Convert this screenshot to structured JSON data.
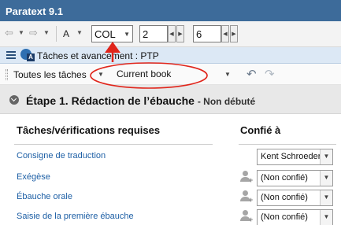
{
  "window": {
    "title": "Paratext 9.1"
  },
  "toolbar": {
    "back_icon": "back-arrow-icon",
    "forward_icon": "forward-arrow-icon",
    "font_label": "A",
    "book": "COL",
    "chapter": "2",
    "verse": "6"
  },
  "panel": {
    "title": "Tâches et avancement : PTP",
    "icon": "project-progress-icon"
  },
  "filterbar": {
    "task_filter": "Toutes les tâches",
    "book_range": "Current book",
    "undo_icon": "undo-icon",
    "redo_icon": "redo-icon"
  },
  "stage": {
    "title": "Étape 1. Rédaction de l’ébauche",
    "status": "- Non débuté"
  },
  "columns": {
    "tasks": "Tâches/vérifications requises",
    "assigned": "Confié à"
  },
  "tasks": [
    {
      "name": "Consigne de traduction",
      "assignee": "Kent Schroeder",
      "show_assign_icon": false
    },
    {
      "name": "Exégèse",
      "assignee": "(Non confié)",
      "show_assign_icon": true
    },
    {
      "name": "Ébauche orale",
      "assignee": "(Non confié)",
      "show_assign_icon": true
    },
    {
      "name": "Saisie de la première ébauche",
      "assignee": "(Non confié)",
      "show_assign_icon": true
    }
  ],
  "colors": {
    "titlebar": "#3d6b9a",
    "panel_header": "#dce8f5",
    "link": "#1d5fa5",
    "annotation_red": "#e0251b"
  }
}
